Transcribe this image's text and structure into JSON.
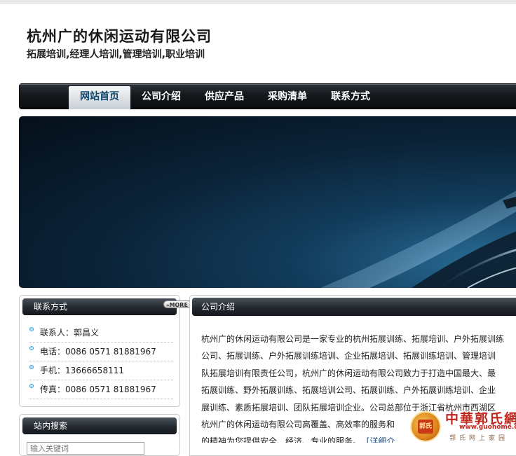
{
  "header": {
    "title": "杭州广的休闲运动有限公司",
    "subtitle": "拓展培训,经理人培训,管理培训,职业培训"
  },
  "nav": {
    "items": [
      {
        "label": "网站首页",
        "active": true
      },
      {
        "label": "公司介绍",
        "active": false
      },
      {
        "label": "供应产品",
        "active": false
      },
      {
        "label": "采购清单",
        "active": false
      },
      {
        "label": "联系方式",
        "active": false
      }
    ]
  },
  "contact": {
    "title": "联系方式",
    "more_label": "MORE",
    "items": [
      "联系人：郭昌义",
      "电话：0086 0571 81881967",
      "手机：13666658111",
      "传真：0086 0571 81881967"
    ]
  },
  "search": {
    "title": "站内搜索",
    "placeholder": "输入关键词"
  },
  "intro": {
    "title": "公司介绍",
    "lines": [
      "杭州广的休闲运动有限公司是一家专业的杭州拓展训练、拓展培训、户外拓展训练",
      "公司、拓展训练、户外拓展训练培训、企业拓展培训、拓展训练培训、管理培训",
      "队拓展培训有限责任公司，杭州广的休闲运动有限公司致力于打造中国最大、最",
      "拓展训练、野外拓展训练、拓展培训公司、拓展训练、户外拓展训练培训、企业",
      "展训练、素质拓展培训、团队拓展培训企业。公司总部位于浙江省杭州市西湖区",
      "杭州广的休闲运动有限公司高覆盖、高效率的服务和"
    ],
    "last_line": "的精神为您提供安全、经济、专业的服务。",
    "detail_link": "[详细介"
  },
  "watermark": {
    "title": "中華郭氏網",
    "url": "www.guohome.org",
    "tagline": "郭氏网上家园",
    "seal_text": "郭氏"
  },
  "colors": {
    "nav_bg": "#15191d",
    "nav_active_text": "#10456a",
    "link": "#1a4f8a",
    "watermark_red": "#c0261c"
  }
}
